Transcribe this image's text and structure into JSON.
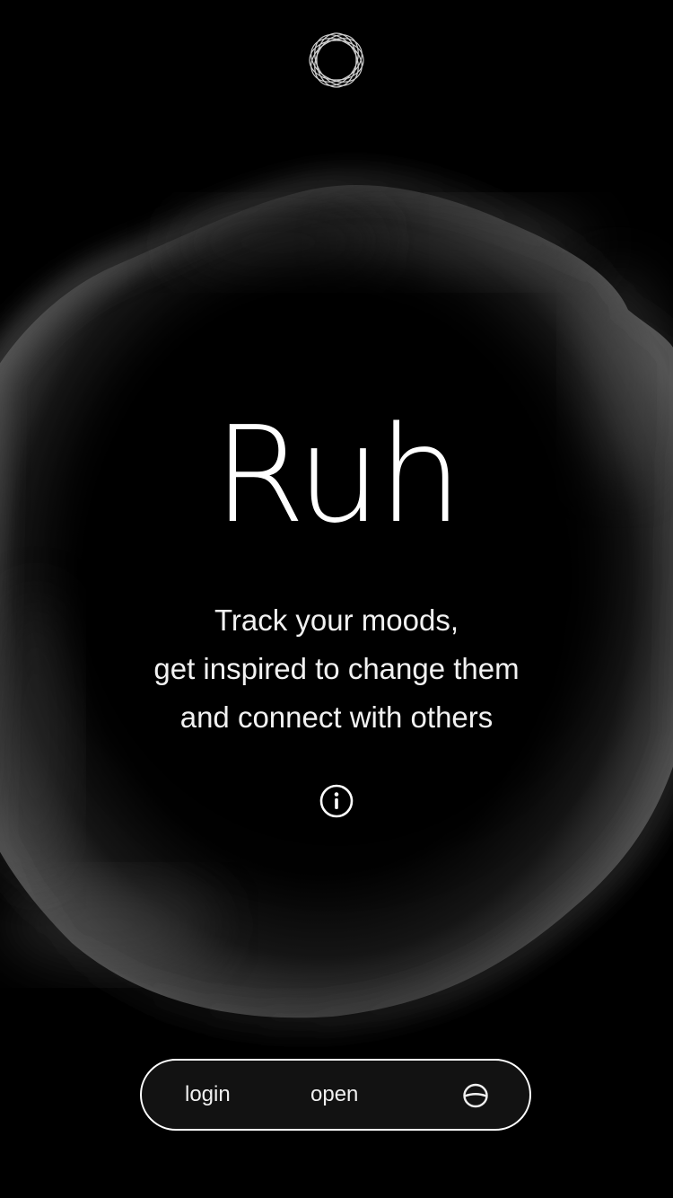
{
  "app": {
    "title": "Ruh",
    "tagline": [
      "Track your moods,",
      "get inspired to change them",
      "and connect with others"
    ]
  },
  "icons": {
    "logo": "rosette-logo-icon",
    "info": "info-icon",
    "globe": "globe-icon"
  },
  "bottom_bar": {
    "login_label": "login",
    "open_label": "open"
  },
  "colors": {
    "background": "#000000",
    "text": "#ffffff",
    "blob_highlight": "#7a7a7a"
  }
}
